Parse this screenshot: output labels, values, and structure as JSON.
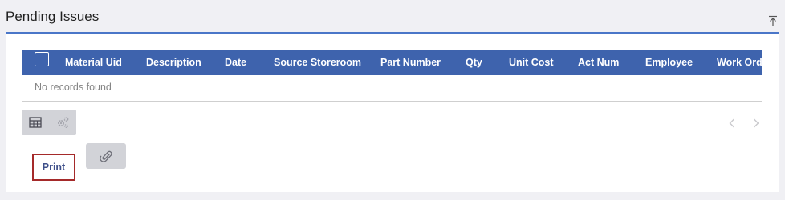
{
  "panel": {
    "title": "Pending Issues"
  },
  "grid": {
    "columns": [
      "Material Uid",
      "Description",
      "Date",
      "Source Storeroom",
      "Part Number",
      "Qty",
      "Unit Cost",
      "Act Num",
      "Employee",
      "Work Orde"
    ],
    "empty_message": "No records found"
  },
  "toolbar": {
    "icons": [
      "grid-view-icon",
      "settings-gears-icon"
    ]
  },
  "pager": {
    "icons": [
      "chevron-left-icon",
      "chevron-right-icon"
    ]
  },
  "actions": {
    "print_label": "Print",
    "attach_icon": "paperclip-icon"
  },
  "colors": {
    "header_bg": "#3e63ad",
    "accent_line": "#4a76c8",
    "print_border": "#a52a2a",
    "print_text": "#3e4f8a",
    "page_bg": "#f0f0f4"
  }
}
